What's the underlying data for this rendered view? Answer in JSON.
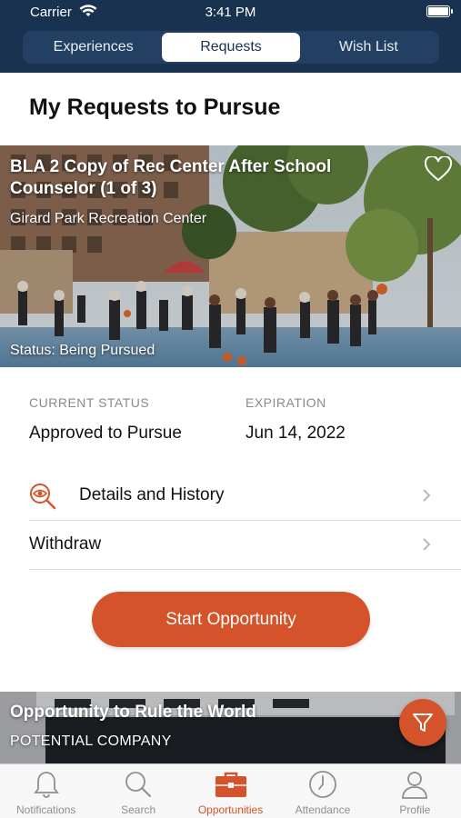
{
  "status_bar": {
    "carrier": "Carrier",
    "time": "3:41 PM"
  },
  "segments": [
    {
      "label": "Experiences",
      "active": false
    },
    {
      "label": "Requests",
      "active": true
    },
    {
      "label": "Wish List",
      "active": false
    }
  ],
  "page_title": "My Requests to Pursue",
  "card1": {
    "title": "BLA 2 Copy of Rec Center After School Counselor (1 of 3)",
    "location": "Girard Park Recreation Center",
    "status": "Status: Being Pursued"
  },
  "details": {
    "current_status_label": "CURRENT STATUS",
    "current_status_value": "Approved to Pursue",
    "expiration_label": "EXPIRATION",
    "expiration_value": "Jun 14, 2022"
  },
  "rows": {
    "details_history": "Details and History",
    "withdraw": "Withdraw"
  },
  "start_button": "Start Opportunity",
  "card2": {
    "title": "Opportunity to Rule the World",
    "company": "POTENTIAL COMPANY"
  },
  "tabs": [
    {
      "label": "Notifications",
      "icon": "bell-icon",
      "active": false
    },
    {
      "label": "Search",
      "icon": "search-icon",
      "active": false
    },
    {
      "label": "Opportunities",
      "icon": "briefcase-icon",
      "active": true
    },
    {
      "label": "Attendance",
      "icon": "clock-icon",
      "active": false
    },
    {
      "label": "Profile",
      "icon": "person-icon",
      "active": false
    }
  ],
  "colors": {
    "navy": "#19324f",
    "accent": "#d4532a"
  }
}
